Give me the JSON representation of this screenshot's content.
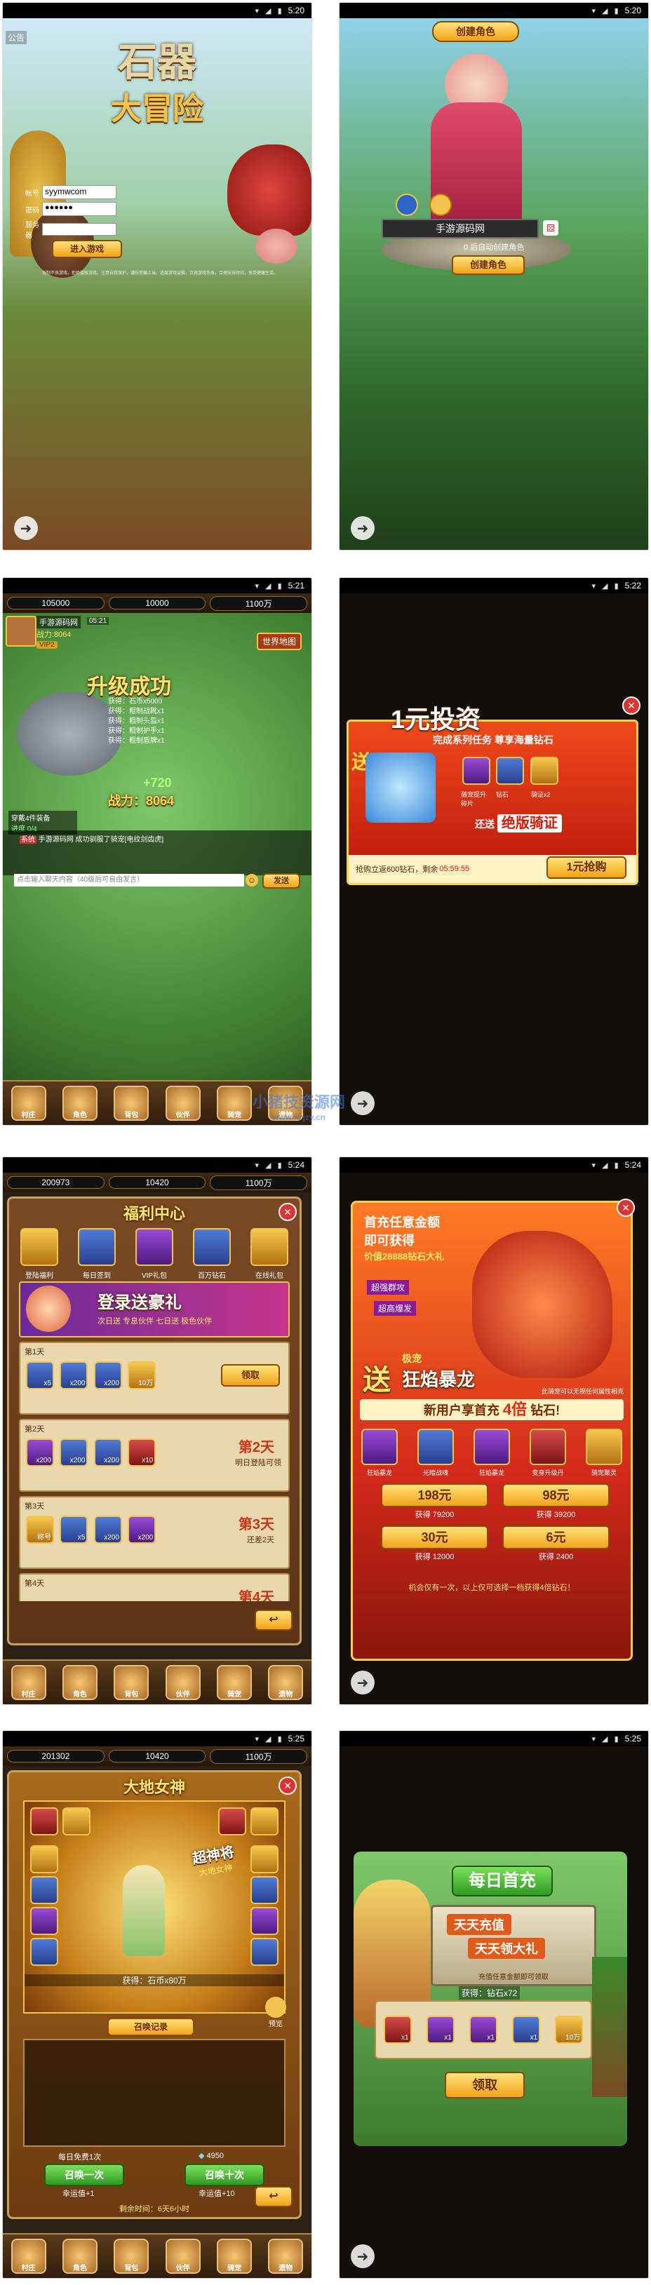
{
  "status_times": [
    "5:20",
    "5:20",
    "5:21",
    "5:22",
    "5:24",
    "5:24",
    "5:25",
    "5:25"
  ],
  "screen1": {
    "game_title_line1": "石器",
    "game_title_line2": "大冒险",
    "corner_label": "公告",
    "account_label": "帐号",
    "account_value": "syymwcom",
    "password_label": "密码",
    "password_value": "●●●●●●",
    "server_label": "服务器",
    "login_button": "进入游戏",
    "footer_text": "抵制不良游戏，拒绝盗版游戏。注意自我保护，谨防受骗上当。适度游戏益脑，沉迷游戏伤身。合理安排时间，享受健康生活。"
  },
  "screen2": {
    "header": "创建角色",
    "name_value": "手游源码网",
    "note": "0 后自动创建角色",
    "create_button": "创建角色"
  },
  "screen3": {
    "res_left": "105000",
    "res_mid": "10000",
    "res_right": "1100万",
    "player_name": "手游源码网",
    "combat_label": "战力:8064",
    "vip": "VIP2",
    "timer": "05:21",
    "world_event": "世界地图",
    "levelup_text": "升级成功",
    "rewards": [
      "获得：石币x5000",
      "获得：粗制战靴x1",
      "获得：粗制头盔x1",
      "获得：粗制护手x1",
      "获得：粗制盾牌x1"
    ],
    "power_gain": "+720",
    "power_total": "战力：8064",
    "equip_label": "穿戴4件装备",
    "equip_sub": "进度 0/4",
    "chat_tag": "系统",
    "chat_line": "手游源码网 成功驯服了骑宠[电纹剑齿虎]",
    "chat_placeholder": "点击输入聊天内容（40级后可自由发言）",
    "send_button": "发送",
    "nav": [
      "村庄",
      "角色",
      "背包",
      "伙伴",
      "骑宠",
      "遗物"
    ]
  },
  "screen4": {
    "title": "1元投资",
    "subtitle": "完成系列任务 尊享海量钻石",
    "send_tag": "送",
    "extra": "还送",
    "extra_highlight": "绝版骑证",
    "items": [
      "骑宠提升碎片",
      "钻石",
      "骑证x2"
    ],
    "footer_left": "抢购立返600钻石，剩余",
    "countdown": "05:59:55",
    "buy_button": "1元抢购"
  },
  "screen5": {
    "res_left": "200973",
    "res_mid": "10420",
    "res_right": "1100万",
    "title": "福利中心",
    "tabs": [
      "登陆福利",
      "每日签到",
      "VIP礼包",
      "百万钻石",
      "在线礼包"
    ],
    "banner_title": "登录送豪礼",
    "banner_sub": "次日送 专息伙伴 七日送 极色伙伴",
    "days": [
      {
        "label": "第1天",
        "items": [
          "x5",
          "x200",
          "x200",
          "10万"
        ],
        "right_button": "领取",
        "right_sub": ""
      },
      {
        "label": "第2天",
        "items": [
          "x200",
          "x200",
          "x200",
          "x10"
        ],
        "right_button": "第2天",
        "right_sub": "明日登陆可领"
      },
      {
        "label": "第3天",
        "items": [
          "称号",
          "x5",
          "x200",
          "x200"
        ],
        "right_button": "第3天",
        "right_sub": "还差2天"
      },
      {
        "label": "第4天",
        "items": [],
        "right_button": "第4天",
        "right_sub": ""
      }
    ],
    "nav": [
      "村庄",
      "角色",
      "背包",
      "伙伴",
      "骑宠",
      "遗物"
    ]
  },
  "screen6": {
    "headline1": "首充任意金额",
    "headline2": "即可获得",
    "headline3": "价值28888钻石大礼",
    "tags": [
      "超强群攻",
      "超高爆发"
    ],
    "send_tag": "送",
    "pet_sub": "极宠",
    "pet_name": "狂焰暴龙",
    "pet_note": "此骑宠可以无视任何属性相克",
    "first_charge": "新用户享首充",
    "multiplier": "4倍",
    "charge_suffix": "钻石!",
    "items": [
      "狂焰暴龙",
      "光暗战魂",
      "狂焰暴龙",
      "变身升级丹",
      "骑宠聚灵"
    ],
    "options": [
      {
        "price": "198元",
        "gain": "获得 79200"
      },
      {
        "price": "98元",
        "gain": "获得 39200"
      },
      {
        "price": "30元",
        "gain": "获得 12000"
      },
      {
        "price": "6元",
        "gain": "获得 2400"
      }
    ],
    "footer": "机会仅有一次，以上仅可选择一档获得4倍钻石！"
  },
  "screen7": {
    "res_left": "201302",
    "res_mid": "10420",
    "res_right": "1100万",
    "title": "大地女神",
    "badge_line1": "超神将",
    "badge_line2": "大地女神",
    "reward_text": "获得：石币x80万",
    "record_button": "召唤记录",
    "preview_label": "预览",
    "free_text": "每日免费1次",
    "cost_value": "4950",
    "summon_once": "召唤一次",
    "summon_ten": "召唤十次",
    "luck_once": "幸运值+1",
    "luck_ten": "幸运值+10",
    "time_left": "剩余时间：6天6小时",
    "nav": [
      "村庄",
      "角色",
      "背包",
      "伙伴",
      "骑宠",
      "遗物"
    ]
  },
  "screen8": {
    "title": "每日首充",
    "line1": "天天充值",
    "line2": "天天领大礼",
    "subline": "充值任意金额即可领取",
    "gain_text": "获得：钻石x72",
    "items": [
      "x1",
      "x1",
      "x1",
      "x1",
      "10万"
    ],
    "claim_button": "领取"
  },
  "watermark": "小猪技资源网",
  "watermark_url": "www.xzjzy.cn"
}
